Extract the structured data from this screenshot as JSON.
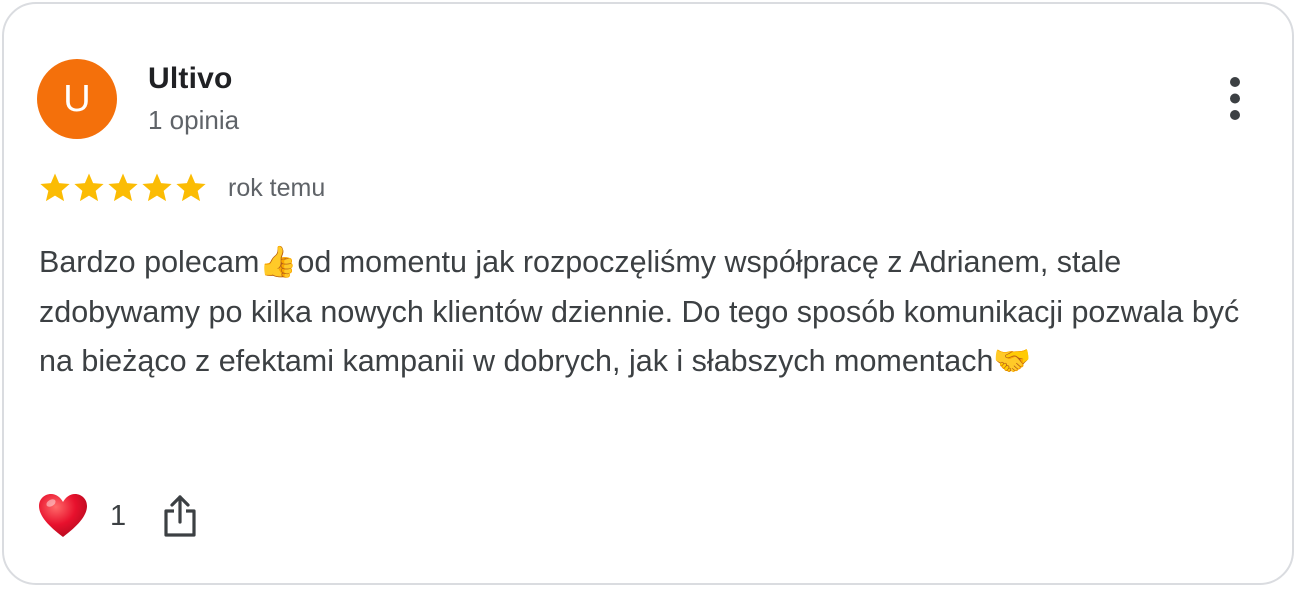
{
  "review": {
    "author": {
      "initial": "U",
      "name": "Ultivo",
      "meta": "1 opinia",
      "avatar_color": "#f4700b"
    },
    "menu_icon": "more-vert-icon",
    "rating": 5,
    "max_rating": 5,
    "star_color": "#fbbc04",
    "date": "rok temu",
    "text": "Bardzo polecam👍od momentu jak rozpoczęliśmy współpracę z Adrianem, stale zdobywamy po kilka nowych klientów dziennie. Do tego sposób komunikacji pozwala być na bieżąco z efektami kampanii w dobrych, jak i słabszych momentach🤝",
    "actions": {
      "like_icon": "heart-icon",
      "like_color": "#e8112d",
      "like_count": "1",
      "share_icon": "share-icon"
    }
  }
}
